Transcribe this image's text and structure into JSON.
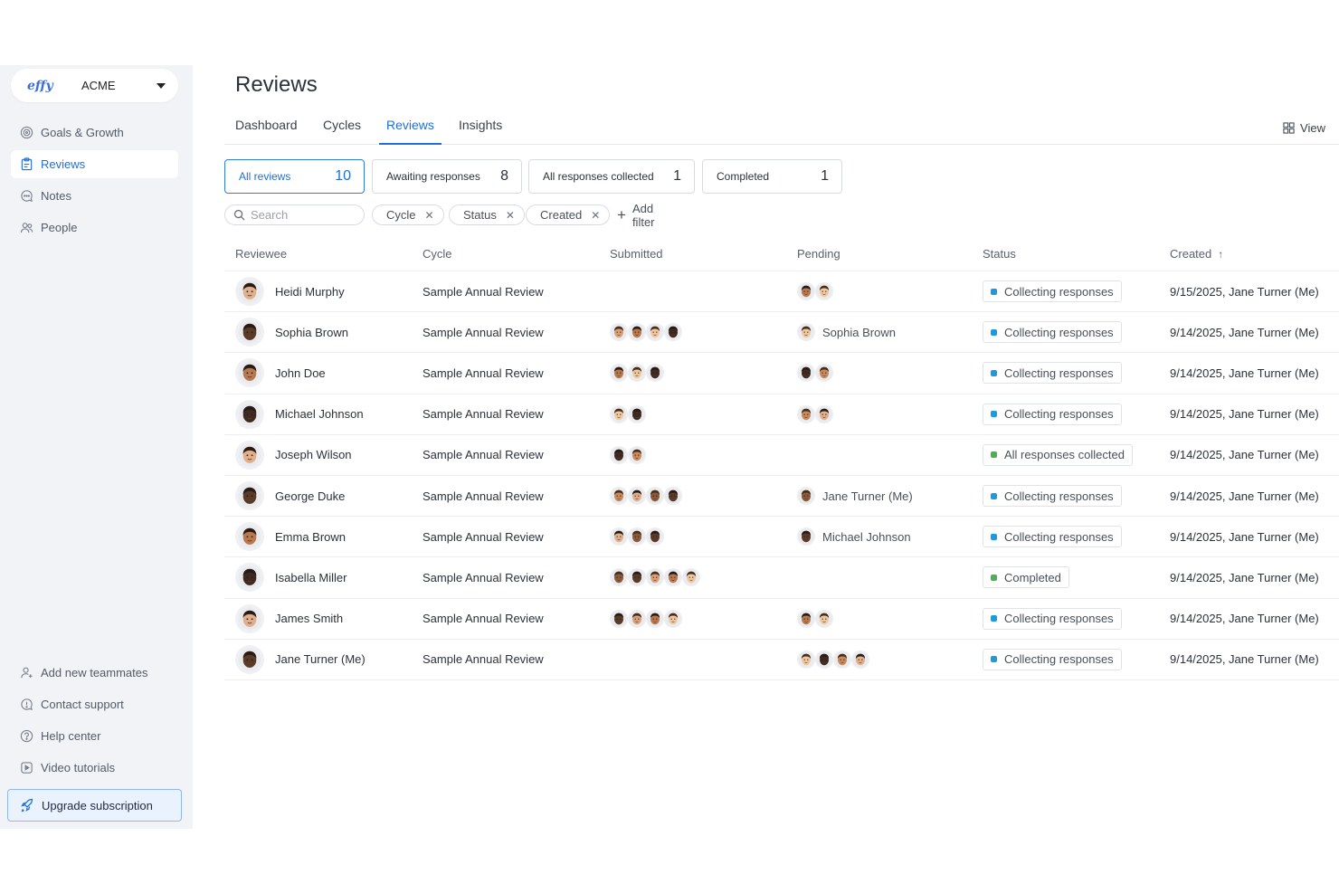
{
  "colors": {
    "accent": "#1f6fe0",
    "collecting": "#1a9be0",
    "collected": "#4caf50",
    "completed": "#4caf50"
  },
  "sidebar": {
    "logo": "effy",
    "org": "ACME",
    "items": [
      {
        "label": "Goals & Growth",
        "icon": "target-icon"
      },
      {
        "label": "Reviews",
        "icon": "clipboard-icon"
      },
      {
        "label": "Notes",
        "icon": "chat-icon"
      },
      {
        "label": "People",
        "icon": "people-icon"
      }
    ],
    "bottom": [
      {
        "label": "Add new teammates",
        "icon": "user-plus-icon"
      },
      {
        "label": "Contact support",
        "icon": "support-icon"
      },
      {
        "label": "Help center",
        "icon": "help-icon"
      },
      {
        "label": "Video tutorials",
        "icon": "play-icon"
      }
    ],
    "upgrade": "Upgrade subscription"
  },
  "main": {
    "title": "Reviews",
    "tabs": [
      "Dashboard",
      "Cycles",
      "Reviews",
      "Insights"
    ],
    "active_tab": "Reviews",
    "view": "View",
    "cards": [
      {
        "label": "All reviews",
        "count": "10"
      },
      {
        "label": "Awaiting responses",
        "count": "8"
      },
      {
        "label": "All responses collected",
        "count": "1"
      },
      {
        "label": "Completed",
        "count": "1"
      }
    ],
    "search_placeholder": "Search",
    "chips": [
      "Cycle",
      "Status",
      "Created"
    ],
    "add_filter": "Add filter",
    "columns": [
      "Reviewee",
      "Cycle",
      "Submitted",
      "Pending",
      "Status",
      "Created"
    ]
  },
  "rows": [
    {
      "reviewee": "Heidi Murphy",
      "cycle": "Sample Annual Review",
      "submitted": 0,
      "pending": 2,
      "pending_name": "",
      "status": "Collecting responses",
      "created": "9/15/2025, Jane Turner (Me)"
    },
    {
      "reviewee": "Sophia Brown",
      "cycle": "Sample Annual Review",
      "submitted": 4,
      "pending": 1,
      "pending_name": "Sophia Brown",
      "status": "Collecting responses",
      "created": "9/14/2025, Jane Turner (Me)"
    },
    {
      "reviewee": "John Doe",
      "cycle": "Sample Annual Review",
      "submitted": 3,
      "pending": 2,
      "pending_name": "",
      "status": "Collecting responses",
      "created": "9/14/2025, Jane Turner (Me)"
    },
    {
      "reviewee": "Michael Johnson",
      "cycle": "Sample Annual Review",
      "submitted": 2,
      "pending": 2,
      "pending_name": "",
      "status": "Collecting responses",
      "created": "9/14/2025, Jane Turner (Me)"
    },
    {
      "reviewee": "Joseph Wilson",
      "cycle": "Sample Annual Review",
      "submitted": 2,
      "pending": 0,
      "pending_name": "",
      "status": "All responses collected",
      "created": "9/14/2025, Jane Turner (Me)"
    },
    {
      "reviewee": "George Duke",
      "cycle": "Sample Annual Review",
      "submitted": 4,
      "pending": 1,
      "pending_name": "Jane Turner (Me)",
      "status": "Collecting responses",
      "created": "9/14/2025, Jane Turner (Me)"
    },
    {
      "reviewee": "Emma Brown",
      "cycle": "Sample Annual Review",
      "submitted": 3,
      "pending": 1,
      "pending_name": "Michael Johnson",
      "status": "Collecting responses",
      "created": "9/14/2025, Jane Turner (Me)"
    },
    {
      "reviewee": "Isabella Miller",
      "cycle": "Sample Annual Review",
      "submitted": 5,
      "pending": 0,
      "pending_name": "",
      "status": "Completed",
      "created": "9/14/2025, Jane Turner (Me)"
    },
    {
      "reviewee": "James Smith",
      "cycle": "Sample Annual Review",
      "submitted": 4,
      "pending": 2,
      "pending_name": "",
      "status": "Collecting responses",
      "created": "9/14/2025, Jane Turner (Me)"
    },
    {
      "reviewee": "Jane Turner (Me)",
      "cycle": "Sample Annual Review",
      "submitted": 0,
      "pending": 4,
      "pending_name": "",
      "status": "Collecting responses",
      "created": "9/14/2025, Jane Turner (Me)"
    }
  ]
}
